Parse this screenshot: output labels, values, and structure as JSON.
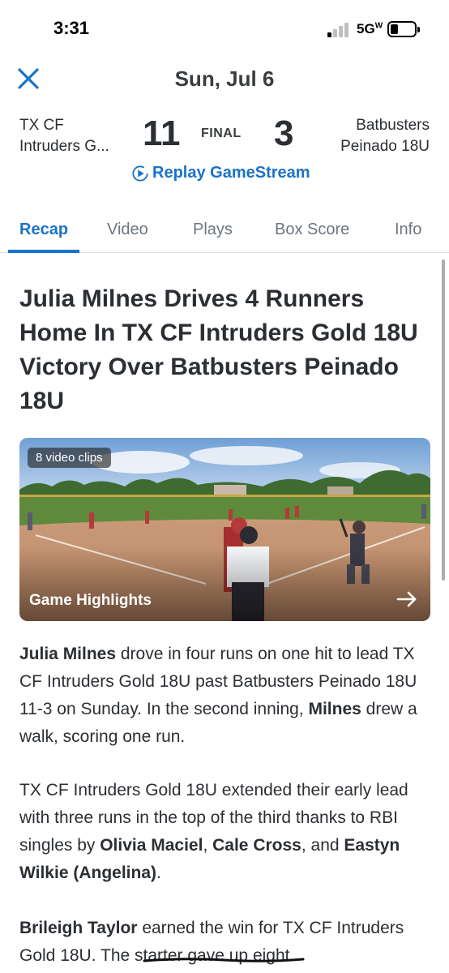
{
  "status_bar": {
    "time": "3:31",
    "network": "5G",
    "network_sup": "W"
  },
  "header": {
    "date": "Sun, Jul 6"
  },
  "scoreboard": {
    "home_team_line1": "TX CF",
    "home_team_line2": "Intruders G...",
    "home_score": "11",
    "status": "FINAL",
    "away_score": "3",
    "away_team_line1": "Batbusters",
    "away_team_line2": "Peinado 18U",
    "replay_label": "Replay GameStream"
  },
  "tabs": [
    {
      "label": "Recap",
      "active": true
    },
    {
      "label": "Video",
      "active": false
    },
    {
      "label": "Plays",
      "active": false
    },
    {
      "label": "Box Score",
      "active": false
    },
    {
      "label": "Info",
      "active": false
    }
  ],
  "article": {
    "headline": "Julia Milnes Drives 4 Runners Home In TX CF Intruders Gold 18U Victory Over Batbusters Peinado 18U",
    "video": {
      "badge": "8 video clips",
      "title": "Game Highlights"
    },
    "p1": {
      "b1": "Julia Milnes",
      "t1": " drove in four runs on one hit to lead TX CF Intruders Gold 18U past Batbusters Peinado 18U 11-3 on Sunday. In the second inning, ",
      "b2": "Milnes",
      "t2": " drew a walk, scoring one run."
    },
    "p2": {
      "t1": "TX CF Intruders Gold 18U extended their early lead with three runs in the top of the third thanks to RBI singles by ",
      "b1": "Olivia Maciel",
      "t2": ", ",
      "b2": "Cale Cross",
      "t3": ", and ",
      "b3": "Eastyn Wilkie (Angelina)",
      "t4": "."
    },
    "p3": {
      "b1": "Brileigh Taylor",
      "t1": " earned the win for TX CF Intruders Gold 18U. The starter gave up eight"
    }
  },
  "colors": {
    "accent": "#1a73c8",
    "text": "#2b2f33",
    "muted": "#6b7680"
  }
}
